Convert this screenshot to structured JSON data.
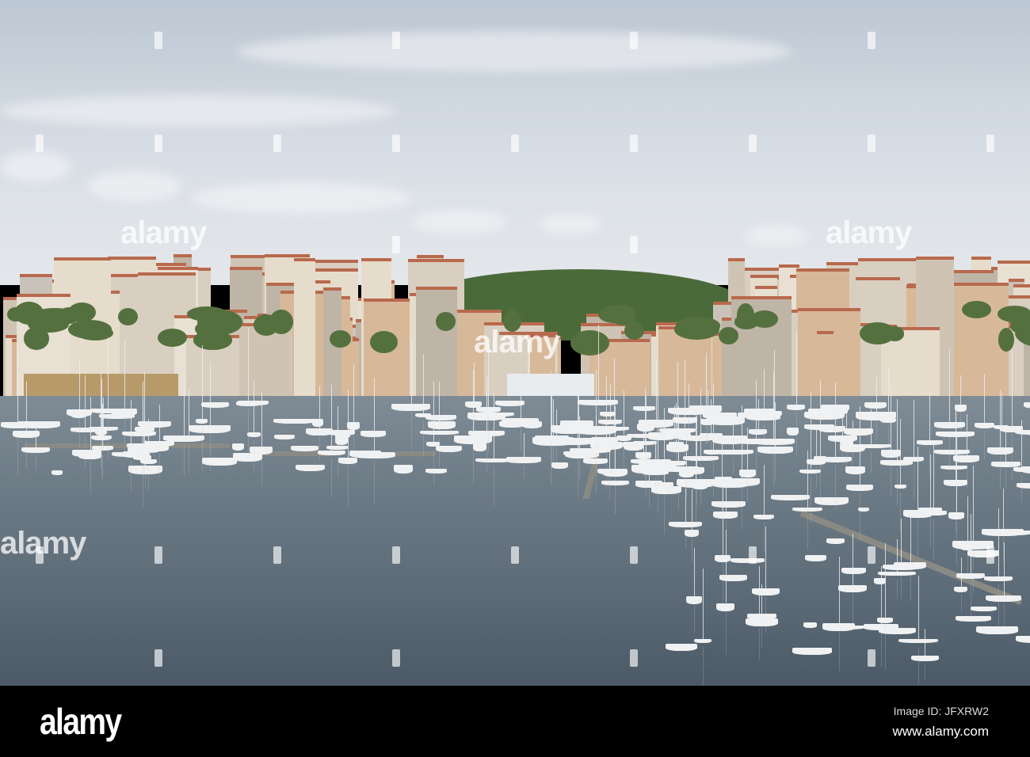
{
  "photo": {
    "subject": "marina-harbour-city"
  },
  "watermark": {
    "text": "alamy"
  },
  "footer": {
    "logo": "alamy",
    "image_id": "Image ID: JFXRW2",
    "website": "www.alamy.com"
  },
  "colors": {
    "roof": "#b8694d",
    "water": "#6e7c87",
    "sky": "#d4dbe2",
    "foliage": "#4b6a3a"
  }
}
